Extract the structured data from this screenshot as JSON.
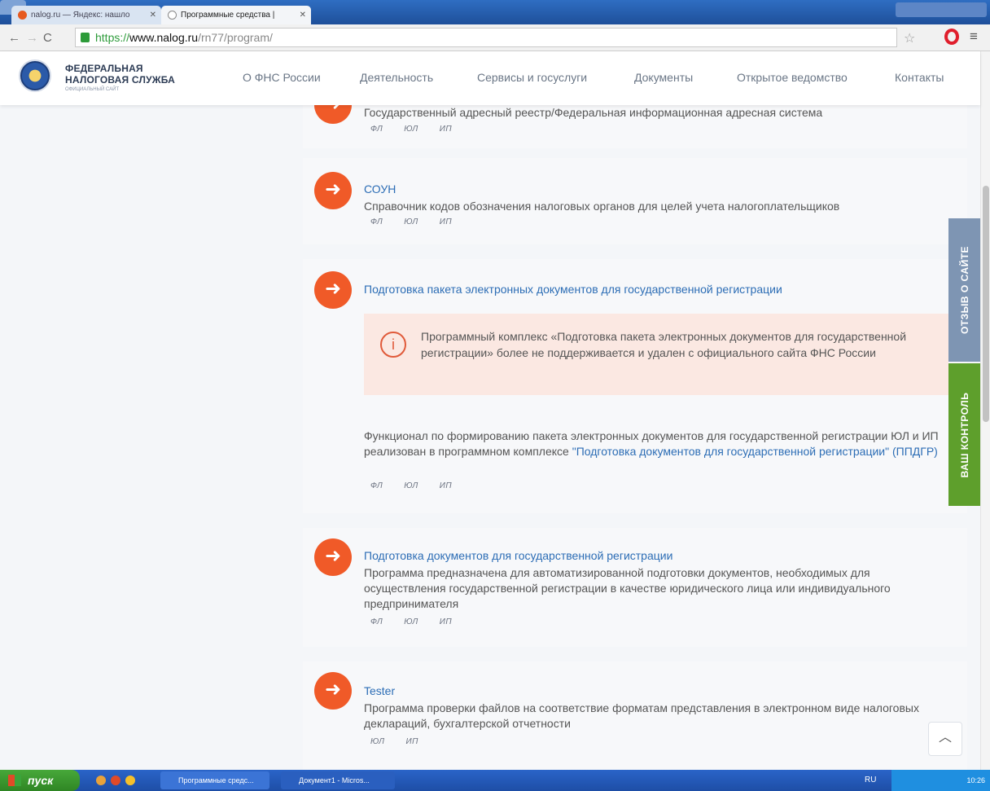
{
  "browser": {
    "tabs": [
      {
        "label": "nalog.ru — Яндекс: нашло"
      },
      {
        "label": "Программные средства |"
      }
    ],
    "url": {
      "scheme": "https://",
      "host": "www.nalog.ru",
      "path": "/rn77/program/"
    }
  },
  "site": {
    "name_line1": "ФЕДЕРАЛЬНАЯ",
    "name_line2": "НАЛОГОВАЯ СЛУЖБА",
    "subtitle": "ОФИЦИАЛЬНЫЙ САЙТ",
    "nav": [
      "О ФНС России",
      "Деятельность",
      "Сервисы и госуслуги",
      "Документы",
      "Открытое ведомство",
      "Контакты"
    ]
  },
  "programs": [
    {
      "title": "",
      "description": "Государственный адресный реестр/Федеральная информационная адресная система",
      "tags": [
        "ФЛ",
        "ЮЛ",
        "ИП"
      ]
    },
    {
      "title": "СОУН",
      "description": "Справочник кодов обозначения налоговых органов для целей учета налогоплательщиков",
      "tags": [
        "ФЛ",
        "ЮЛ",
        "ИП"
      ]
    },
    {
      "title": "Подготовка пакета электронных документов для государственной регистрации",
      "warning": "Программный комплекс «Подготовка пакета электронных документов для государственной регистрации» более не поддерживается и удален с официального сайта ФНС России",
      "note_text": "Функционал по формированию пакета электронных документов для государственной регистрации ЮЛ и ИП реализован в программном комплексе ",
      "note_link": "\"Подготовка документов для государственной регистрации\" (ППДГР)",
      "tags": [
        "ФЛ",
        "ЮЛ",
        "ИП"
      ]
    },
    {
      "title": "Подготовка документов для государственной регистрации",
      "description": "Программа предназначена для автоматизированной подготовки документов, необходимых для осуществления государственной регистрации в качестве юридического лица или индивидуального предпринимателя",
      "tags": [
        "ФЛ",
        "ЮЛ",
        "ИП"
      ]
    },
    {
      "title": "Tester",
      "description": "Программа проверки файлов на соответствие форматам представления в электронном виде налоговых деклараций, бухгалтерской отчетности",
      "tags": [
        "ЮЛ",
        "ИП"
      ]
    }
  ],
  "side_tabs": {
    "feedback": "ОТЗЫВ О САЙТЕ",
    "control": "ВАШ КОНТРОЛЬ"
  },
  "taskbar": {
    "start": "пуск",
    "tasks": [
      "Программные средс...",
      "Документ1 - Micros..."
    ],
    "lang": "RU",
    "clock": "10:26"
  },
  "icons": {
    "card": "arrow-right-icon",
    "warning": "info-icon",
    "scroll_top": "chevron-up-icon"
  },
  "colors": {
    "accent": "#f05a28",
    "link": "#2c6db5",
    "warning_bg": "#fbe8e2",
    "control_tab": "#5e9f2c",
    "feedback_tab": "#7e95b3"
  }
}
